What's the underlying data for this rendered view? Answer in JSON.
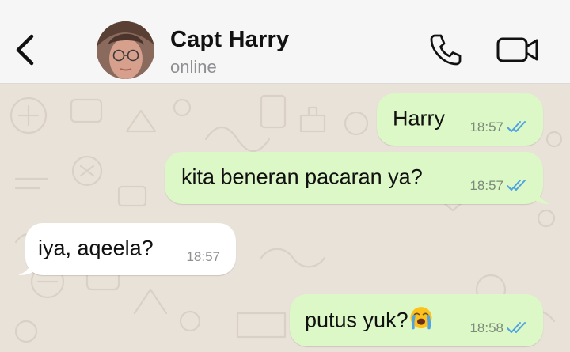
{
  "header": {
    "contact_name": "Capt Harry",
    "status": "online",
    "icons": {
      "back": "chevron-left-icon",
      "call": "phone-icon",
      "video": "video-camera-icon"
    }
  },
  "colors": {
    "header_bg": "#f6f6f6",
    "chat_bg": "#e9e2d8",
    "outgoing_bubble": "#dcf8c6",
    "incoming_bubble": "#ffffff",
    "read_ticks": "#4fa3e0"
  },
  "messages": [
    {
      "direction": "outgoing",
      "text": "Harry",
      "time": "18:57",
      "status": "read"
    },
    {
      "direction": "outgoing",
      "text": "kita beneran pacaran ya?",
      "time": "18:57",
      "status": "read"
    },
    {
      "direction": "incoming",
      "text": "iya, aqeela?",
      "time": "18:57"
    },
    {
      "direction": "outgoing",
      "text": "putus yuk?",
      "emoji": "loudly-crying-face",
      "time": "18:58",
      "status": "read"
    }
  ]
}
